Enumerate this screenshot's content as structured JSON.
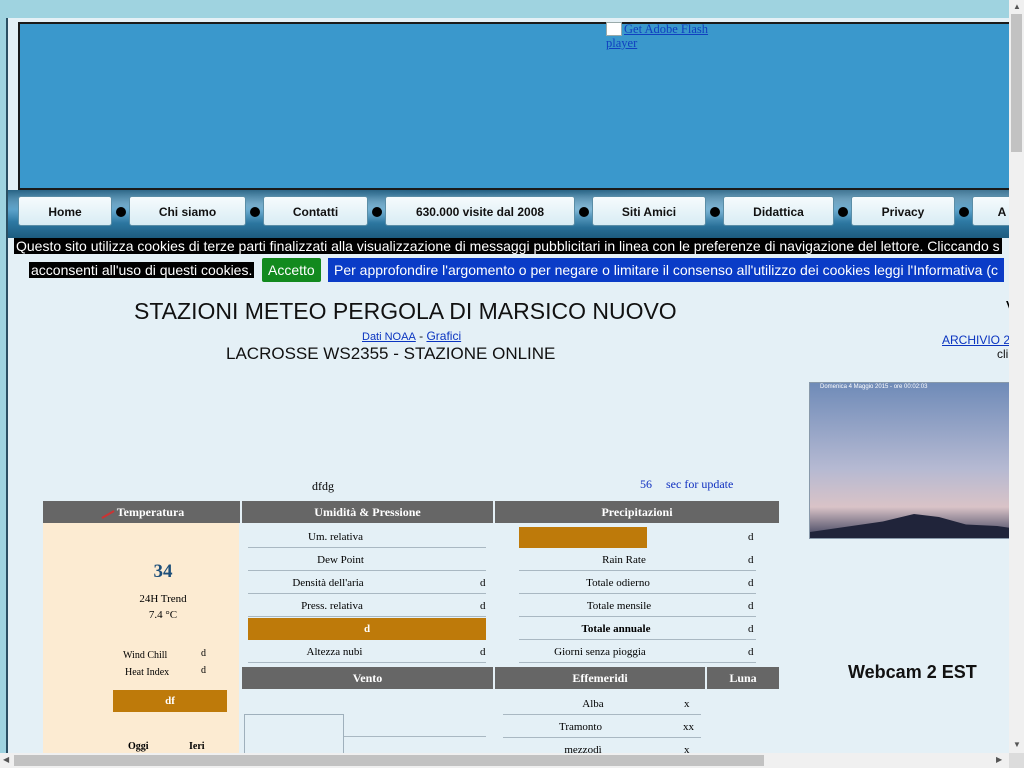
{
  "flash": {
    "alt": "Get Adobe Flash player"
  },
  "nav": [
    "Home",
    "Chi siamo",
    "Contatti",
    "630.000 visite dal 2008",
    "Siti Amici",
    "Didattica",
    "Privacy",
    "A"
  ],
  "cookie": {
    "line1": "Questo sito utilizza cookies di terze parti finalizzati alla visualizzazione di messaggi pubblicitari in linea con le preferenze di navigazione del lettore. Cliccando s",
    "line2": "acconsenti all'uso di questi cookies.",
    "accept": "Accetto",
    "more": "Per approfondire l'argomento o per negare o limitare il consenso all'utilizzo dei cookies leggi l'Informativa (c"
  },
  "header": {
    "title": "STAZIONI METEO PERGOLA DI MARSICO NUOVO",
    "link_noaa": "Dati NOAA",
    "separator": " - ",
    "link_grafici": "Grafici",
    "subtitle": "LACROSSE WS2355 - STAZIONE ONLINE"
  },
  "right": {
    "letter": "V",
    "archive": "ARCHIVIO 2",
    "archive_sub": "cli"
  },
  "webcam": {
    "timestamp": "Domenica 4 Maggio 2015 - ore 00:02:03",
    "label": "Webcam 2  EST"
  },
  "misc": {
    "dfdg": "dfdg",
    "countdown": "56",
    "countdown_label": "sec for update"
  },
  "headers": {
    "temperatura": "Temperatura",
    "umidita": "Umidità & Pressione",
    "precipitazioni": "Precipitazioni",
    "vento": "Vento",
    "effemeridi": "Effemeridi",
    "luna": "Luna"
  },
  "temperature": {
    "value": "34",
    "trend_label": "24H Trend",
    "trend_value": "7.4 °C",
    "wind_chill_label": "Wind Chill",
    "wind_chill_value": "d",
    "heat_index_label": "Heat Index",
    "heat_index_value": "d",
    "bar": "df",
    "today": "Oggi",
    "yesterday": "Ieri"
  },
  "humidity": [
    {
      "label": "Um. relativa",
      "value": ""
    },
    {
      "label": "Dew Point",
      "value": ""
    },
    {
      "label": "Densità dell'aria",
      "value": "d"
    },
    {
      "label": "Press. relativa",
      "value": "d"
    },
    {
      "label": "Altezza nubi",
      "value": "d"
    }
  ],
  "humidity_bar": "d",
  "precip": [
    {
      "label": "",
      "value": "d"
    },
    {
      "label": "Rain Rate",
      "value": "d"
    },
    {
      "label": "Totale odierno",
      "value": "d"
    },
    {
      "label": "Totale mensile",
      "value": "d"
    },
    {
      "label": "Totale annuale",
      "value": "d"
    },
    {
      "label": "Giorni senza pioggia",
      "value": "d"
    }
  ],
  "ephem": [
    {
      "label": "Alba",
      "value": "x"
    },
    {
      "label": "Tramonto",
      "value": "xx"
    },
    {
      "label": "mezzodì",
      "value": "x"
    }
  ],
  "colors": {
    "banner": "#3a98cc",
    "orange": "#be7a0a",
    "accept": "#128a1e",
    "info": "#0a3cc7"
  }
}
